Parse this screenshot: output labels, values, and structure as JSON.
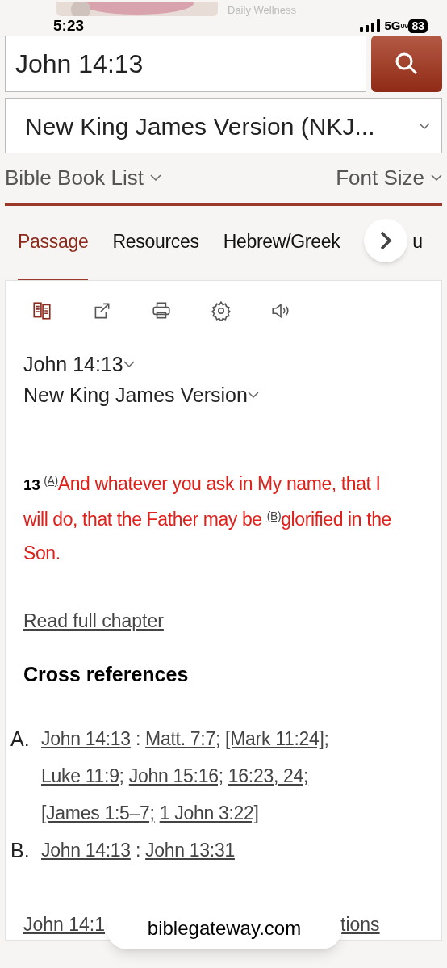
{
  "notification": {
    "title": "Daily Wellness"
  },
  "status_bar": {
    "time": "5:23",
    "network": "5G",
    "network_suffix": "UW",
    "battery": "83"
  },
  "search": {
    "value": "John 14:13"
  },
  "version_select": {
    "value": "New King James Version (NKJ..."
  },
  "options": [
    {
      "label": "Bible Book List"
    },
    {
      "label": "Font Size"
    }
  ],
  "tabs": [
    {
      "label": "Passage",
      "selected": true
    },
    {
      "label": "Resources",
      "selected": false
    },
    {
      "label": "Hebrew/Greek",
      "selected": false
    },
    {
      "label": "u",
      "selected": false
    }
  ],
  "toolbar": [
    {
      "kind": "parallel",
      "active": true
    },
    {
      "kind": "share",
      "active": false
    },
    {
      "kind": "print",
      "active": false
    },
    {
      "kind": "settings",
      "active": false
    },
    {
      "kind": "audio",
      "active": false
    }
  ],
  "passage": {
    "reference": "John 14:13",
    "version": "New King James Version",
    "verse": {
      "number": "13",
      "parts": [
        {
          "note": "(A)",
          "text": "And whatever you ask in My name, that I will do, that the Father may be "
        },
        {
          "note": "(B)",
          "text": "glorified in the Son."
        }
      ]
    },
    "read_full_chapter": "Read full chapter",
    "cross_references_title": "Cross references",
    "cross_references": [
      {
        "letter": "A.",
        "source": "John 14:13",
        "separator": ":",
        "targets": [
          "Matt. 7:7;",
          "[Mark 11:24];",
          "Luke 11:9;",
          "John 15:16;",
          "16:23, 24;",
          "[James 1:5–7;",
          "1 John 3:22]"
        ]
      },
      {
        "letter": "B.",
        "source": "John 14:13",
        "separator": ":",
        "targets": [
          "John 13:31"
        ]
      }
    ],
    "all_translations": {
      "start": "John 14:1",
      "end": "tions"
    }
  },
  "url_pill": "biblegateway.com"
}
